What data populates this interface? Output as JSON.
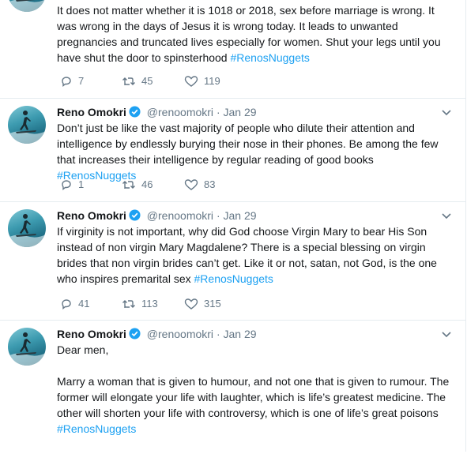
{
  "accent_color": "#1da1f2",
  "text_color": "#14171a",
  "meta_color": "#657786",
  "tweets": [
    {
      "name": "",
      "handle": "",
      "date": "",
      "text": "It does not matter whether it is 1018 or 2018, sex before marriage is wrong. It was wrong in the days of Jesus it is wrong today. It leads to unwanted pregnancies and truncated lives especially for women. Shut your legs until you have shut the door to spinsterhood ",
      "hashtag": "#RenosNuggets",
      "replies": "7",
      "retweets": "45",
      "likes": "119"
    },
    {
      "name": "Reno Omokri",
      "handle": "@renoomokri",
      "dot": "·",
      "date": "Jan 29",
      "text": "Don’t just be like the vast majority of people who dilute their attention and intelligence by endlessly burying their nose in their phones. Be among the few that increases their intelligence by regular reading of good books ",
      "hashtag": "#RenosNuggets",
      "replies": "1",
      "retweets": "46",
      "likes": "83"
    },
    {
      "name": "Reno Omokri",
      "handle": "@renoomokri",
      "dot": "·",
      "date": "Jan 29",
      "text": "If virginity is not important, why did God choose Virgin Mary to bear His Son instead of non virgin Mary Magdalene? There is a special blessing on virgin brides that non virgin brides can’t get. Like it or not, satan, not God, is the one who inspires premarital sex ",
      "hashtag": "#RenosNuggets",
      "replies": "41",
      "retweets": "113",
      "likes": "315"
    },
    {
      "name": "Reno Omokri",
      "handle": "@renoomokri",
      "dot": "·",
      "date": "Jan 29",
      "text": "Dear men,\n\nMarry a woman that is given to humour, and not one that is given to rumour. The former will elongate your life with laughter, which is life’s greatest medicine. The other will shorten your life with controversy, which is one of life’s great poisons\n",
      "hashtag": "#RenosNuggets",
      "replies": "",
      "retweets": "",
      "likes": ""
    }
  ]
}
